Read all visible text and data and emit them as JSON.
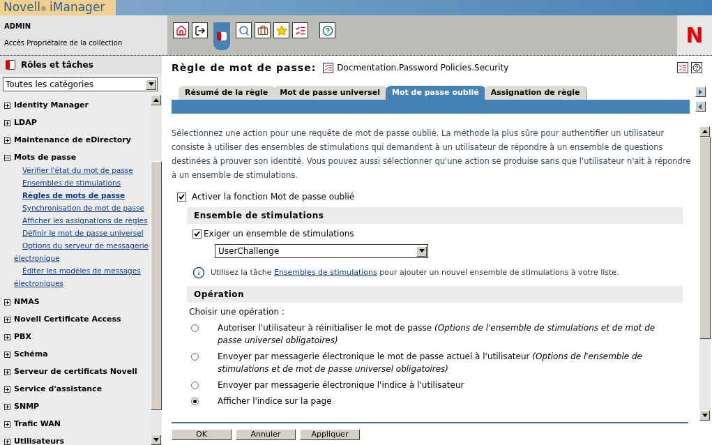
{
  "header": {
    "product": "Novell",
    "registered": "®",
    "app": "iManager",
    "user": "ADMIN",
    "access": "Accès Propriétaire de la collection",
    "logo_letter": "N"
  },
  "sidebar": {
    "title": "Rôles et tâches",
    "category_select": "Toutes les catégories",
    "items": [
      {
        "label": "Identity Manager",
        "expanded": false
      },
      {
        "label": "LDAP",
        "expanded": false
      },
      {
        "label": "Maintenance de eDirectory",
        "expanded": false
      },
      {
        "label": "Mots de passe",
        "expanded": true,
        "children": [
          {
            "label": "Vérifier l'état du mot de passe",
            "selected": false
          },
          {
            "label": "Ensembles de stimulations",
            "selected": false
          },
          {
            "label": "Règles de mots de passe",
            "selected": true
          },
          {
            "label": "Synchronisation de mot de passe",
            "selected": false
          },
          {
            "label": "Afficher les assignations de règles",
            "selected": false
          },
          {
            "label": "Définir le mot de passe universel",
            "selected": false
          },
          {
            "label": "Options du serveur de messagerie électronique",
            "selected": false
          },
          {
            "label": "Éditer les modèles de messages électroniques",
            "selected": false
          }
        ]
      },
      {
        "label": "NMAS",
        "expanded": false
      },
      {
        "label": "Novell Certificate Access",
        "expanded": false
      },
      {
        "label": "PBX",
        "expanded": false
      },
      {
        "label": "Schéma",
        "expanded": false
      },
      {
        "label": "Serveur de certificats Novell",
        "expanded": false
      },
      {
        "label": "Service d'assistance",
        "expanded": false
      },
      {
        "label": "SNMP",
        "expanded": false
      },
      {
        "label": "Trafic WAN",
        "expanded": false
      },
      {
        "label": "Utilisateurs",
        "expanded": false
      }
    ]
  },
  "page": {
    "title": "Règle de mot de passe:",
    "object": "Docmentation.Password Policies.Security"
  },
  "tabs": [
    {
      "label": "Résumé de la règle",
      "selected": false
    },
    {
      "label": "Mot de passe universel",
      "selected": false
    },
    {
      "label": "Mot de passe oublié",
      "selected": true
    },
    {
      "label": "Assignation de règle",
      "selected": false
    }
  ],
  "description": "Sélectionnez une action pour une requête de mot de passe oublié. La méthode la plus sûre pour authentifier un utilisateur consiste à utiliser des ensembles de stimulations qui demandent à un utilisateur de répondre à un ensemble de questions destinées à prouver son identité. Vous pouvez aussi sélectionner qu'une action se produise sans que l'utilisateur n'ait à répondre à un ensemble de stimulations.",
  "enable_checkbox": {
    "label": "Activer la fonction Mot de passe oublié",
    "checked": true
  },
  "challenge_section": {
    "heading": "Ensemble de stimulations",
    "require_checkbox": {
      "label": "Exiger un ensemble de stimulations",
      "checked": true
    },
    "select_value": "UserChallenge",
    "info_before": "Utilisez la tâche",
    "info_link": "Ensembles de stimulations",
    "info_after": "pour ajouter un nouvel ensemble de stimulations à votre liste."
  },
  "operation_section": {
    "heading": "Opération",
    "prompt": "Choisir une opération :",
    "options": [
      {
        "label": "Autoriser l'utilisateur à réinitialiser le mot de passe *(Options de l'ensemble de stimulations et de mot de passe universel obligatoires)*",
        "selected": false
      },
      {
        "label": "Envoyer par messagerie électronique le mot de passe actuel à l'utilisateur *(Options de l'ensemble de stimulations et de mot de passe universel obligatoires)*",
        "selected": false
      },
      {
        "label": "Envoyer par messagerie électronique l'indice à l'utilisateur",
        "selected": false
      },
      {
        "label": "Afficher l'indice sur la page",
        "selected": true
      }
    ]
  },
  "buttons": [
    "OK",
    "Annuler",
    "Appliquer"
  ]
}
